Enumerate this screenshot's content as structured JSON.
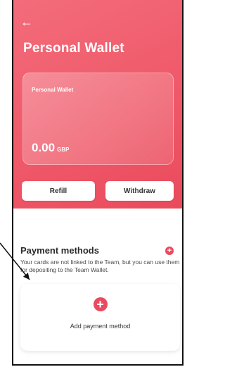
{
  "header": {
    "back_icon": "arrow-left-icon",
    "title": "Personal Wallet"
  },
  "wallet_card": {
    "label": "Personal Wallet",
    "amount": "0.00",
    "currency": "GBP"
  },
  "actions": {
    "refill": "Refill",
    "withdraw": "Withdraw"
  },
  "payment_methods": {
    "title": "Payment methods",
    "description": "Your cards are not linked to the Team, but you can use them for depositing to the Team Wallet.",
    "add_label": "Add payment method"
  },
  "colors": {
    "accent": "#ea4a5f",
    "gradient_start": "#f36c7b",
    "gradient_end": "#e94a5c"
  }
}
